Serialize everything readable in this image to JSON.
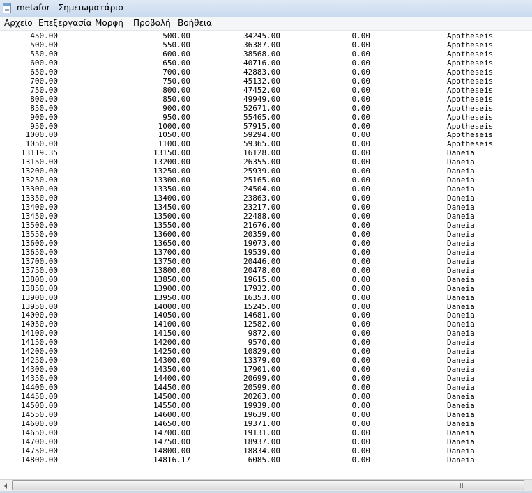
{
  "window": {
    "title": "metafor - Σημειωματάριο",
    "icon": "notepad-icon"
  },
  "menu": [
    "Αρχείο",
    "Επεξεργασία",
    "Μορφή",
    "Προβολή",
    "Βοήθεια"
  ],
  "rows": [
    [
      "450.00",
      "500.00",
      "34245.00",
      "0.00",
      "Apotheseis"
    ],
    [
      "500.00",
      "550.00",
      "36387.00",
      "0.00",
      "Apotheseis"
    ],
    [
      "550.00",
      "600.00",
      "38568.00",
      "0.00",
      "Apotheseis"
    ],
    [
      "600.00",
      "650.00",
      "40716.00",
      "0.00",
      "Apotheseis"
    ],
    [
      "650.00",
      "700.00",
      "42883.00",
      "0.00",
      "Apotheseis"
    ],
    [
      "700.00",
      "750.00",
      "45132.00",
      "0.00",
      "Apotheseis"
    ],
    [
      "750.00",
      "800.00",
      "47452.00",
      "0.00",
      "Apotheseis"
    ],
    [
      "800.00",
      "850.00",
      "49949.00",
      "0.00",
      "Apotheseis"
    ],
    [
      "850.00",
      "900.00",
      "52671.00",
      "0.00",
      "Apotheseis"
    ],
    [
      "900.00",
      "950.00",
      "55465.00",
      "0.00",
      "Apotheseis"
    ],
    [
      "950.00",
      "1000.00",
      "57915.00",
      "0.00",
      "Apotheseis"
    ],
    [
      "1000.00",
      "1050.00",
      "59294.00",
      "0.00",
      "Apotheseis"
    ],
    [
      "1050.00",
      "1100.00",
      "59365.00",
      "0.00",
      "Apotheseis"
    ],
    [
      "13119.35",
      "13150.00",
      "16128.00",
      "0.00",
      "Daneia"
    ],
    [
      "13150.00",
      "13200.00",
      "26355.00",
      "0.00",
      "Daneia"
    ],
    [
      "13200.00",
      "13250.00",
      "25939.00",
      "0.00",
      "Daneia"
    ],
    [
      "13250.00",
      "13300.00",
      "25165.00",
      "0.00",
      "Daneia"
    ],
    [
      "13300.00",
      "13350.00",
      "24504.00",
      "0.00",
      "Daneia"
    ],
    [
      "13350.00",
      "13400.00",
      "23863.00",
      "0.00",
      "Daneia"
    ],
    [
      "13400.00",
      "13450.00",
      "23217.00",
      "0.00",
      "Daneia"
    ],
    [
      "13450.00",
      "13500.00",
      "22488.00",
      "0.00",
      "Daneia"
    ],
    [
      "13500.00",
      "13550.00",
      "21676.00",
      "0.00",
      "Daneia"
    ],
    [
      "13550.00",
      "13600.00",
      "20359.00",
      "0.00",
      "Daneia"
    ],
    [
      "13600.00",
      "13650.00",
      "19073.00",
      "0.00",
      "Daneia"
    ],
    [
      "13650.00",
      "13700.00",
      "19539.00",
      "0.00",
      "Daneia"
    ],
    [
      "13700.00",
      "13750.00",
      "20446.00",
      "0.00",
      "Daneia"
    ],
    [
      "13750.00",
      "13800.00",
      "20478.00",
      "0.00",
      "Daneia"
    ],
    [
      "13800.00",
      "13850.00",
      "19615.00",
      "0.00",
      "Daneia"
    ],
    [
      "13850.00",
      "13900.00",
      "17932.00",
      "0.00",
      "Daneia"
    ],
    [
      "13900.00",
      "13950.00",
      "16353.00",
      "0.00",
      "Daneia"
    ],
    [
      "13950.00",
      "14000.00",
      "15245.00",
      "0.00",
      "Daneia"
    ],
    [
      "14000.00",
      "14050.00",
      "14681.00",
      "0.00",
      "Daneia"
    ],
    [
      "14050.00",
      "14100.00",
      "12582.00",
      "0.00",
      "Daneia"
    ],
    [
      "14100.00",
      "14150.00",
      "9872.00",
      "0.00",
      "Daneia"
    ],
    [
      "14150.00",
      "14200.00",
      "9570.00",
      "0.00",
      "Daneia"
    ],
    [
      "14200.00",
      "14250.00",
      "10829.00",
      "0.00",
      "Daneia"
    ],
    [
      "14250.00",
      "14300.00",
      "13379.00",
      "0.00",
      "Daneia"
    ],
    [
      "14300.00",
      "14350.00",
      "17901.00",
      "0.00",
      "Daneia"
    ],
    [
      "14350.00",
      "14400.00",
      "20699.00",
      "0.00",
      "Daneia"
    ],
    [
      "14400.00",
      "14450.00",
      "20599.00",
      "0.00",
      "Daneia"
    ],
    [
      "14450.00",
      "14500.00",
      "20263.00",
      "0.00",
      "Daneia"
    ],
    [
      "14500.00",
      "14550.00",
      "19939.00",
      "0.00",
      "Daneia"
    ],
    [
      "14550.00",
      "14600.00",
      "19639.00",
      "0.00",
      "Daneia"
    ],
    [
      "14600.00",
      "14650.00",
      "19371.00",
      "0.00",
      "Daneia"
    ],
    [
      "14650.00",
      "14700.00",
      "19131.00",
      "0.00",
      "Daneia"
    ],
    [
      "14700.00",
      "14750.00",
      "18937.00",
      "0.00",
      "Daneia"
    ],
    [
      "14750.00",
      "14800.00",
      "18834.00",
      "0.00",
      "Daneia"
    ],
    [
      "14800.00",
      "14816.17",
      "6085.00",
      "0.00",
      "Daneia"
    ]
  ]
}
